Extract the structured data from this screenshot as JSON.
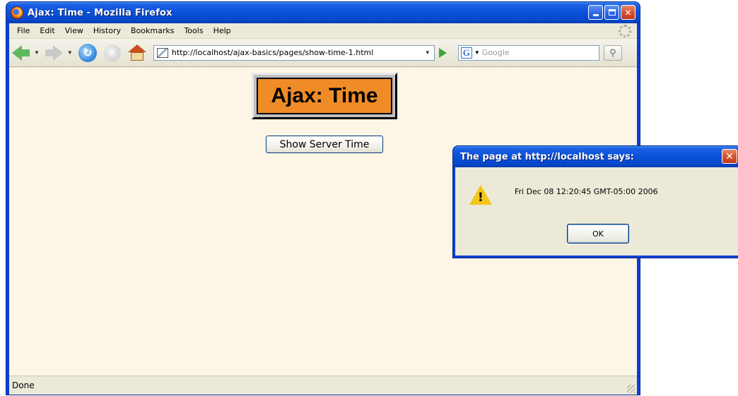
{
  "window": {
    "title": "Ajax: Time - Mozilla Firefox",
    "menu": [
      "File",
      "Edit",
      "View",
      "History",
      "Bookmarks",
      "Tools",
      "Help"
    ]
  },
  "toolbar": {
    "url": "http://localhost/ajax-basics/pages/show-time-1.html",
    "search_placeholder": "Google"
  },
  "page": {
    "heading": "Ajax: Time",
    "button_label": "Show Server Time"
  },
  "status": {
    "text": "Done"
  },
  "alert": {
    "title": "The page at http://localhost says:",
    "message": "Fri Dec 08 12:20:45 GMT-05:00 2006",
    "ok_label": "OK"
  },
  "colors": {
    "titlebar": "#0851d9",
    "page_background": "#fdf5e6",
    "heading_background": "#f08c28"
  }
}
